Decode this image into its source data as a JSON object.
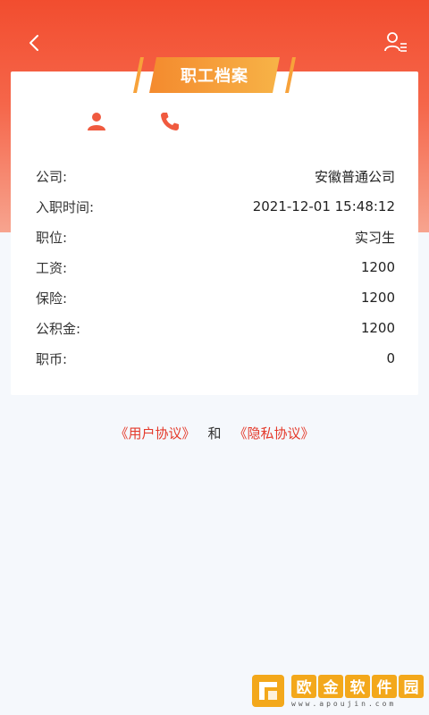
{
  "header": {
    "title": "职工档案",
    "back_icon": "chevron-left-icon",
    "user_menu_icon": "user-list-icon"
  },
  "contacts": {
    "person_icon": "person-icon",
    "phone_icon": "phone-icon"
  },
  "info": [
    {
      "label": "公司:",
      "value": "安徽普通公司"
    },
    {
      "label": "入职时间:",
      "value": "2021-12-01 15:48:12"
    },
    {
      "label": "职位:",
      "value": "实习生"
    },
    {
      "label": "工资:",
      "value": "1200"
    },
    {
      "label": "保险:",
      "value": "1200"
    },
    {
      "label": "公积金:",
      "value": "1200"
    },
    {
      "label": "职币:",
      "value": "0"
    }
  ],
  "agreements": {
    "user": "《用户协议》",
    "and": "和",
    "privacy": "《隐私协议》"
  },
  "watermark": {
    "chars": [
      "欧",
      "金",
      "软",
      "件",
      "园"
    ],
    "url": "www.apoujin.com"
  },
  "colors": {
    "accent": "#f24d2f",
    "badge": "#f7a23a",
    "link": "#e4392a"
  }
}
